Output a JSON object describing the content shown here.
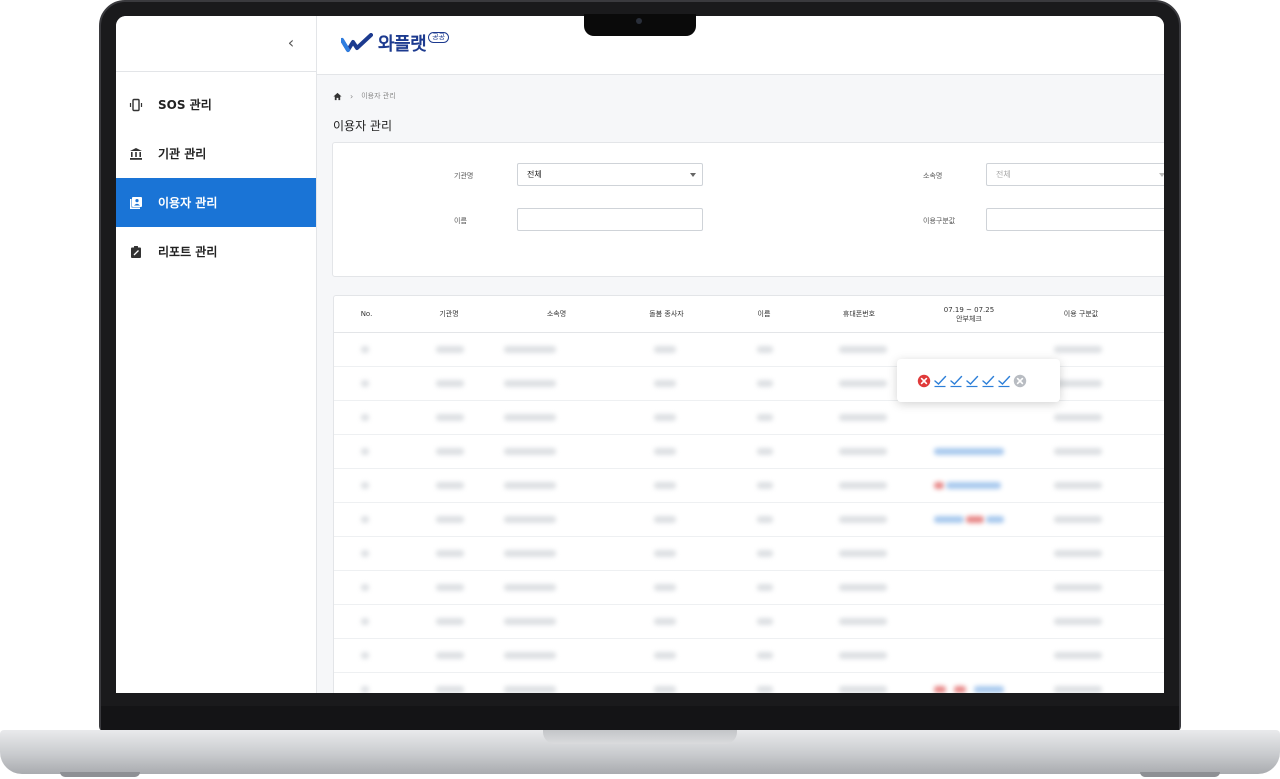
{
  "sidebar": {
    "items": [
      {
        "label": "SOS 관리",
        "icon": "sos-phone-icon"
      },
      {
        "label": "기관 관리",
        "icon": "institution-icon"
      },
      {
        "label": "이용자 관리",
        "icon": "user-book-icon",
        "active": true
      },
      {
        "label": "리포트 관리",
        "icon": "report-icon"
      }
    ],
    "collapse_glyph": "‹"
  },
  "header": {
    "logo_text": "와플랫",
    "logo_badge": "공공"
  },
  "breadcrumb": {
    "current": "이용자 관리"
  },
  "page": {
    "title": "이용자 관리"
  },
  "filters": {
    "institution": {
      "label": "기관명",
      "value": "전체"
    },
    "affiliation": {
      "label": "소속명",
      "value": "전체"
    },
    "name": {
      "label": "이름",
      "value": ""
    },
    "usage_type": {
      "label": "이용구분값",
      "value": ""
    }
  },
  "table": {
    "headers": [
      "No.",
      "기관명",
      "소속명",
      "돌봄 종사자",
      "이름",
      "휴대폰번호",
      "07.19 ~ 07.25",
      "안부체크",
      "이용 구분값"
    ]
  },
  "colors": {
    "accent": "#1a74d6",
    "logo": "#1c3a8f",
    "check_fail": "#e03a3a",
    "check_ok": "#2d7fd8",
    "check_none": "#b8bcc2"
  },
  "safety_check": {
    "states": [
      "fail",
      "ok",
      "ok",
      "ok",
      "ok",
      "ok",
      "none"
    ]
  }
}
